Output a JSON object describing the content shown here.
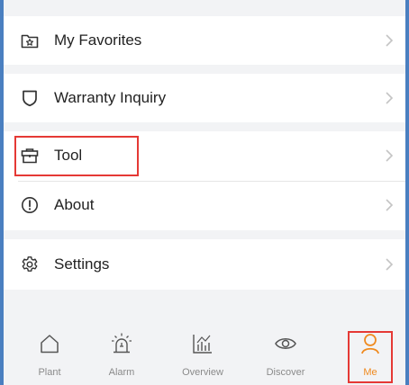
{
  "menu": {
    "favorites": {
      "label": "My Favorites",
      "icon": "star-box-icon"
    },
    "warranty": {
      "label": "Warranty Inquiry",
      "icon": "shield-icon"
    },
    "tool": {
      "label": "Tool",
      "icon": "toolbox-icon"
    },
    "about": {
      "label": "About",
      "icon": "info-circle-icon"
    },
    "settings": {
      "label": "Settings",
      "icon": "gear-icon"
    }
  },
  "tabbar": {
    "tabs": [
      {
        "label": "Plant",
        "icon": "home-icon"
      },
      {
        "label": "Alarm",
        "icon": "alarm-icon"
      },
      {
        "label": "Overview",
        "icon": "bar-chart-icon"
      },
      {
        "label": "Discover",
        "icon": "eye-icon"
      },
      {
        "label": "Me",
        "icon": "person-icon",
        "active": true
      }
    ]
  },
  "colors": {
    "accent": "#ef8a1f",
    "highlight": "#e53935",
    "frame": "#4a7fc0",
    "background": "#f2f3f5"
  }
}
